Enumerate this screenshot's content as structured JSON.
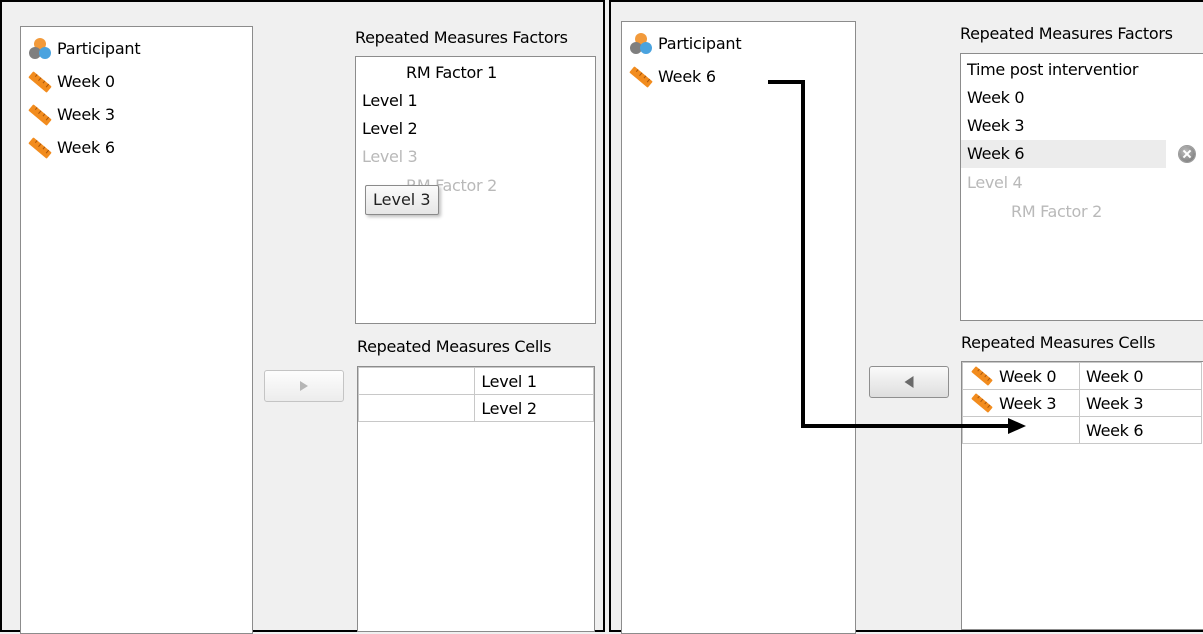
{
  "icons": {
    "nominal": "nominal-variable-icon",
    "scale": "scale-ruler-icon",
    "remove": "remove-circle-icon",
    "assign_right": "arrow-right-icon",
    "assign_left": "arrow-left-icon"
  },
  "colors": {
    "ruler": "#f28c1e",
    "nominal_orange": "#f29a3b",
    "nominal_blue": "#4aa3df",
    "nominal_gray": "#7f7f7f",
    "dim_text": "#b9b9b9"
  },
  "left_panel": {
    "variables": [
      "Participant",
      "Week 0",
      "Week 3",
      "Week 6"
    ],
    "factors_label": "Repeated Measures Factors",
    "factors": {
      "factor_name": "RM Factor 1",
      "levels": [
        "Level 1",
        "Level 2"
      ],
      "new_level_placeholder": "Level 3",
      "new_factor_placeholder": "RM Factor 2",
      "drag_tooltip": "Level 3"
    },
    "cells_label": "Repeated Measures Cells",
    "cells": [
      [
        "",
        "Level 1"
      ],
      [
        "",
        "Level 2"
      ]
    ]
  },
  "right_panel": {
    "variables": [
      "Participant",
      "Week 6"
    ],
    "factors_label": "Repeated Measures Factors",
    "factors": {
      "factor_name": "Time post interventior",
      "levels": [
        "Week 0",
        "Week 3",
        "Week 6"
      ],
      "new_level_placeholder": "Level 4",
      "new_factor_placeholder": "RM Factor 2"
    },
    "cells_label": "Repeated Measures Cells",
    "cells": [
      [
        "Week 0",
        "Week 0"
      ],
      [
        "Week 3",
        "Week 3"
      ],
      [
        "",
        "Week 6"
      ]
    ]
  }
}
